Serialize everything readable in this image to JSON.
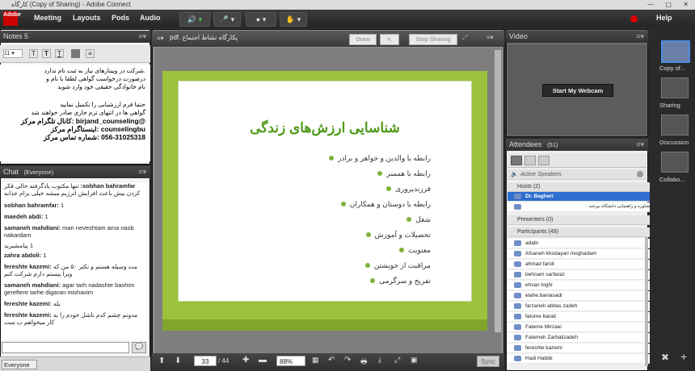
{
  "window": {
    "title": "کارگاه (Copy of Sharing) - Adobe Connect"
  },
  "menubar": {
    "logo": "Adobe",
    "items": [
      "Meeting",
      "Layouts",
      "Pods",
      "Audio"
    ],
    "help": "Help"
  },
  "notes": {
    "title": "Notes 5",
    "lines": [
      ".شرکت در وبینارهای نیاز به ثبت نام ندارد",
      "درصورت درخواست گواهی لطفا با نام و",
      "نام خانوادگی حقیقی خود وارد شوید",
      "حتما فرم ارزشیابی را تکمیل نمایید",
      "گواهی ها در انتهای ترم جاری صادر خواهند شد",
      "@birjand_counseling :کانال تلگرام مرکز",
      "counselingbu :اینستاگرام مرکز",
      "056-31025318 :شماره تماس مرکز"
    ]
  },
  "chat": {
    "title": "Chat",
    "audience": "(Everyone)",
    "to_label": "Everyone",
    "messages": [
      {
        "name": "sobhan bahramfar:",
        "text": "تنها مکتوب یادگرفته حالی فکر کردن بیش باعث افزایش انرژیم میشه خیلی برام جذابه"
      },
      {
        "name": "sobhan bahramfar:",
        "text": "1"
      },
      {
        "name": "maedeh abdi:",
        "text": "1"
      },
      {
        "name": "samaneh mahdiani:",
        "text": "man neveshtam ama nasb nakardam"
      },
      {
        "name": "",
        "text": "1 پیامشیرید"
      },
      {
        "name": "zahra abdoli:",
        "text": "1"
      },
      {
        "name": "fereshte kazemi:",
        "text": "مت وسیله هستم و نکتر ۵۰ من که ویرا پیستم دارم شرکت کنم"
      },
      {
        "name": "samaneh mahdiani:",
        "text": "agar tarh nadashte bashim gereftere tarhe digaran mishavim"
      },
      {
        "name": "fereshte kazemi:",
        "text": "پله"
      },
      {
        "name": "fereshte kazemi:",
        "text": "مدونم چشم کدم ناشل خودم را به کار میخواهم ب ست"
      }
    ]
  },
  "share": {
    "file": "پکارگاه نشاط اجتماع .pdf",
    "draw": "Draw",
    "stop": "Stop Sharing",
    "page": "33",
    "total": "/ 44",
    "zoom": "88%",
    "sync": "Sync",
    "slide_title": "شناسایی ارزش‌های زندگی",
    "bullets": [
      "رابطه با والدین و خواهر و برادر",
      "رابطه با همسر",
      "فرزندپروری",
      "رابطه با دوستان و همکاران",
      "شغل",
      "تحصیلات و آموزش",
      "معنویت",
      "مراقبت از خویشتن",
      "تفریح و سرگرمی"
    ]
  },
  "video": {
    "title": "Video",
    "webcam": "Start My Webcam"
  },
  "attendees": {
    "title": "Attendees",
    "count": "(51)",
    "active_speakers": "Active Speakers",
    "hosts_label": "Hosts (2)",
    "hosts": [
      "Dr. Bagheri",
      "مرکز مشاوره و راهنمایی دانشگاه بیرجند"
    ],
    "presenters_label": "Presenters (0)",
    "participants_label": "Participants (49)",
    "participants": [
      "adabi",
      "Afsaneh khodayari moghadam",
      "ahmad faridi",
      "behnam sarfaraz",
      "ehsan toghi",
      "elahe.baniasadi",
      "farzaneh abbas zadeh",
      "fatome barati",
      "Fateme Mirzaei",
      "Fatemeh Zarbalizadeh",
      "fereshte kazemi",
      "Hadi Habibi"
    ]
  },
  "layouts": {
    "items": [
      "Copy of...",
      "Sharing",
      "Discussion",
      "Collabo..."
    ]
  },
  "colors": {
    "slide_green": "#9ac23c",
    "slide_title": "#4f9a1a",
    "selected_row": "#2f6fcf"
  }
}
